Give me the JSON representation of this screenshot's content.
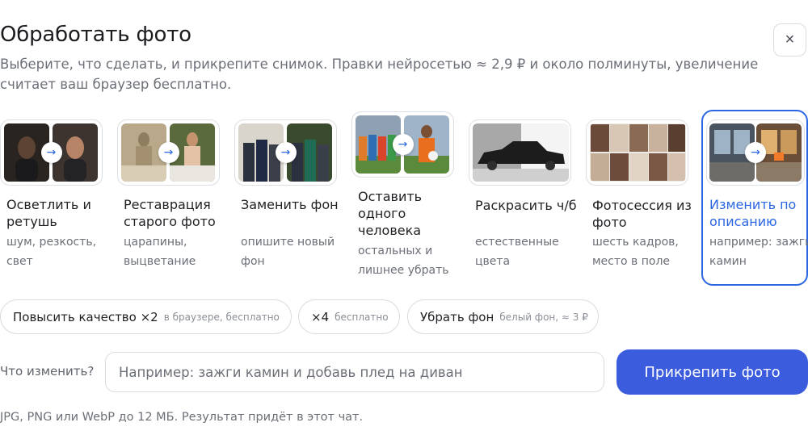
{
  "header": {
    "title": "Обработать фото",
    "subtitle": "Выберите, что сделать, и прикрепите снимок. Правки нейросетью ≈ 2,9 ₽ и около полминуты, увеличение считает ваш браузер бесплатно.",
    "close_label": "×"
  },
  "arrow_glyph": "→",
  "cards": [
    {
      "title": "Осветлить и ретушь",
      "desc": "шум, резкость, свет"
    },
    {
      "title": "Реставрация старого фото",
      "desc": "царапины, выцветание"
    },
    {
      "title": "Заменить фон",
      "desc": "опишите новый фон"
    },
    {
      "title": "Оставить одного человека",
      "desc": "остальных и лишнее убрать"
    },
    {
      "title": "Раскрасить ч/б",
      "desc": "естественные цвета"
    },
    {
      "title": "Фотосессия из фото",
      "desc": "шесть кадров, место в поле"
    },
    {
      "title": "Изменить по описанию",
      "desc": "например: зажги камин"
    }
  ],
  "chips": [
    {
      "label": "Повысить качество ×2",
      "note": "в браузере, бесплатно"
    },
    {
      "label": "×4",
      "note": "бесплатно"
    },
    {
      "label": "Убрать фон",
      "note": "белый фон, ≈ 3 ₽"
    }
  ],
  "prompt": {
    "label": "Что изменить?",
    "placeholder": "Например: зажги камин и добавь плед на диван",
    "value": ""
  },
  "attach_button": "Прикрепить фото",
  "footnote": "JPG, PNG или WebP до 12 МБ. Результат придёт в этот чат.",
  "colors": {
    "accent": "#2b66e3",
    "button": "#3b5cdc",
    "border": "#d9dbe0",
    "muted": "#6b6f77"
  }
}
